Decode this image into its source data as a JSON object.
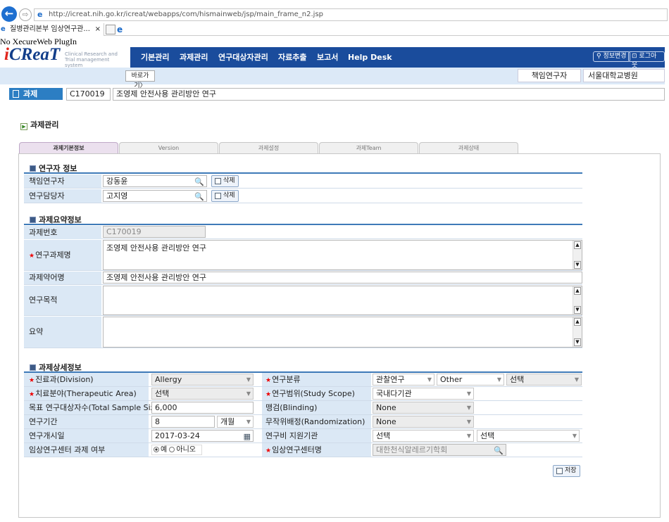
{
  "browser": {
    "url": "http://icreat.nih.go.kr/icreat/webapps/com/hismainweb/jsp/main_frame_n2.jsp",
    "tab_title": "질병관리본부 임상연구관...",
    "tab_close": "×",
    "back_icon": "←",
    "forward_icon": "⇨"
  },
  "plugin_notice": "No XecureWeb PlugIn",
  "logo": {
    "text_i": "i",
    "text_main": "CReaT",
    "subtitle": "Clinical Research and Trial management system"
  },
  "nav": {
    "items": [
      "기본관리",
      "과제관리",
      "연구대상자관리",
      "자료추출",
      "보고서",
      "Help Desk"
    ],
    "info_change": "정보변경",
    "logout": "로그아웃"
  },
  "subbar": {
    "shortcut": "바로가기",
    "pi_label": "책임연구자",
    "pi_value": "서울대학교병원"
  },
  "project": {
    "badge": "과제",
    "code": "C170019",
    "name": "조영제 안전사용 관리방안 연구"
  },
  "section_title": "과제관리",
  "tabs": [
    "과제기본정보",
    "Version",
    "과제설정",
    "과제Team",
    "과제상태"
  ],
  "researcher": {
    "heading": "연구자 정보",
    "pi_label": "책임연구자",
    "pi_value": "강동윤",
    "manager_label": "연구담당자",
    "manager_value": "고지영",
    "delete_label": "삭제"
  },
  "summary": {
    "heading": "과제요약정보",
    "no_label": "과제번호",
    "no_value": "C170019",
    "title_label": "연구과제명",
    "title_value": "조영제 안전사용 관리방안 연구",
    "short_label": "과제약어명",
    "short_value": "조영제 안전사용 관리방안 연구",
    "purpose_label": "연구목적",
    "purpose_value": "",
    "abstract_label": "요약",
    "abstract_value": ""
  },
  "detail": {
    "heading": "과제상세정보",
    "division_label": "진료과(Division)",
    "division_value": "Allergy",
    "therapeutic_label": "치료분야(Therapeutic Area)",
    "therapeutic_value": "선택",
    "sample_label": "목표 연구대상자수(Total Sample Size)",
    "sample_value": "6,000",
    "period_label": "연구기간",
    "period_value": "8",
    "period_unit": "개월",
    "start_label": "연구개시일",
    "start_value": "2017-03-24",
    "center_flag_label": "임상연구센터 과제 여부",
    "yes": "예",
    "no": "아니오",
    "category_label": "연구분류",
    "category_values": [
      "관찰연구",
      "Other",
      "선택"
    ],
    "scope_label": "연구범위(Study Scope)",
    "scope_value": "국내다기관",
    "blinding_label": "맹검(Blinding)",
    "blinding_value": "None",
    "random_label": "무작위배정(Randomization)",
    "random_value": "None",
    "funding_label": "연구비 지원기관",
    "funding_values": [
      "선택",
      "선택"
    ],
    "center_label": "임상연구센터명",
    "center_value": "대한천식알레르기학회"
  },
  "save_label": "저장"
}
